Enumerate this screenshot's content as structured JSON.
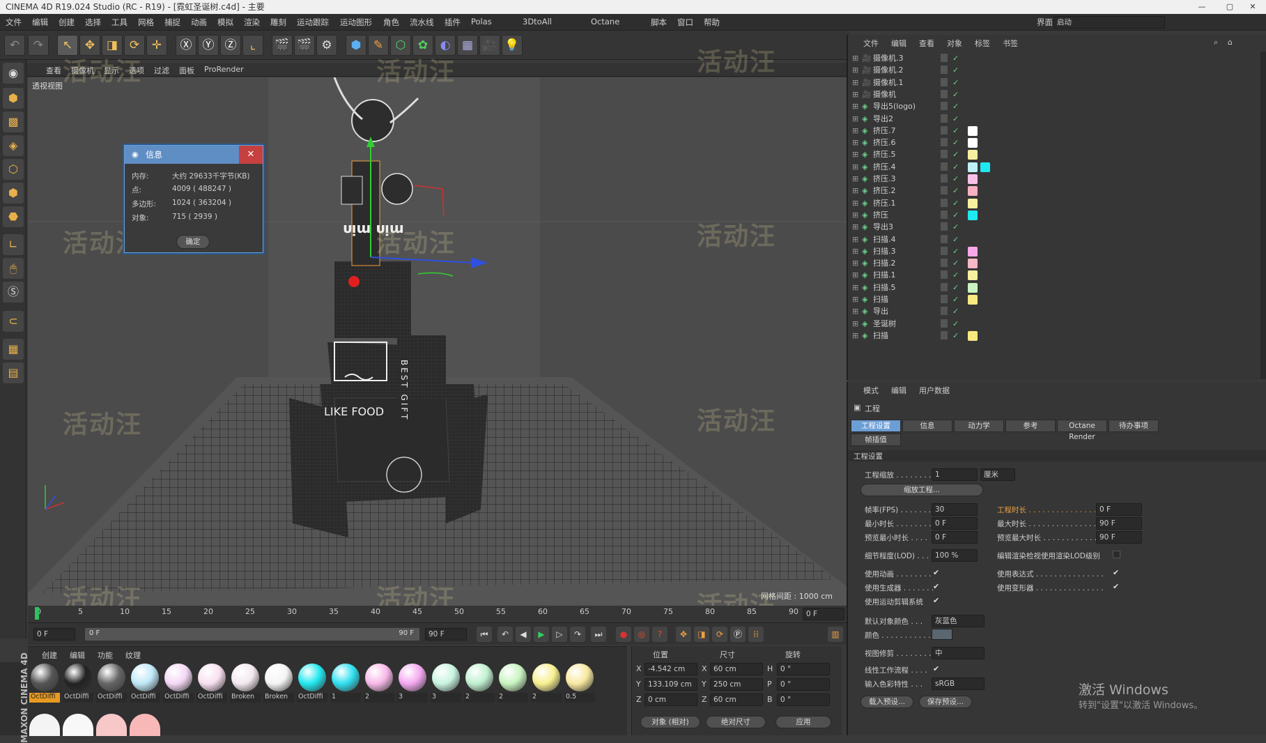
{
  "window": {
    "title": "CINEMA 4D R19.024 Studio (RC - R19) - [霓虹圣诞树.c4d] - 主要",
    "layout_label": "界面:",
    "layout_value": "启动"
  },
  "menu": [
    "文件",
    "编辑",
    "创建",
    "选择",
    "工具",
    "网格",
    "捕捉",
    "动画",
    "模拟",
    "渲染",
    "雕刻",
    "运动跟踪",
    "运动图形",
    "角色",
    "流水线",
    "插件",
    "Polas",
    "3DtoAll",
    "Octane",
    "脚本",
    "窗口",
    "帮助"
  ],
  "viewport": {
    "menu": [
      "查看",
      "摄像机",
      "显示",
      "选项",
      "过滤",
      "面板",
      "ProRender"
    ],
    "label": "透视视图",
    "grid_spacing": "网格间距 : 1000 cm"
  },
  "info_dialog": {
    "title": "信息",
    "close": "✕",
    "ok": "确定",
    "rows": [
      {
        "k": "内存:",
        "v": "大约 29633千字节(KB)"
      },
      {
        "k": "点:",
        "v": "4009 ( 488247 )"
      },
      {
        "k": "多边形:",
        "v": "1024 ( 363204 )"
      },
      {
        "k": "对象:",
        "v": "715 ( 2939 )"
      }
    ]
  },
  "scene": {
    "box_text": "LIKE FOOD",
    "side_text": "BEST GIFT",
    "mid_text": "ᴜᴉɯ ᴜᴉɯ"
  },
  "watermark": "活动汪",
  "timeline": {
    "ticks": [
      "0",
      "5",
      "10",
      "15",
      "20",
      "25",
      "30",
      "35",
      "40",
      "45",
      "50",
      "55",
      "60",
      "65",
      "70",
      "75",
      "80",
      "85",
      "90"
    ],
    "end_field": "0 F"
  },
  "transport": {
    "current": "0 F",
    "range_start": "0 F",
    "range_end": "90 F",
    "max": "90 F"
  },
  "materials": {
    "menu": [
      "创建",
      "编辑",
      "功能",
      "纹理"
    ],
    "items": [
      {
        "label": "OctDiffi",
        "color": "#555"
      },
      {
        "label": "OctDiffi",
        "color": "#222"
      },
      {
        "label": "OctDiffi",
        "color": "#666"
      },
      {
        "label": "OctDiffi",
        "color": "#bfe8f8"
      },
      {
        "label": "OctDiffi",
        "color": "#f4d8f4"
      },
      {
        "label": "OctDiffi",
        "color": "#f8e0f0"
      },
      {
        "label": "Broken",
        "color": "#f4e8f0"
      },
      {
        "label": "Broken",
        "color": "#f4f4f4"
      },
      {
        "label": "OctDiffi",
        "color": "#20e8f0"
      },
      {
        "label": "1",
        "color": "#30e0f0"
      },
      {
        "label": "2",
        "color": "#f8b8e8"
      },
      {
        "label": "3",
        "color": "#f4a8f0"
      },
      {
        "label": "3",
        "color": "#c8f4e0"
      },
      {
        "label": "2",
        "color": "#c0f0d0"
      },
      {
        "label": "2",
        "color": "#c8f4c0"
      },
      {
        "label": "2",
        "color": "#f8f090"
      },
      {
        "label": "0.5",
        "color": "#f8e8a0"
      }
    ]
  },
  "coords": {
    "headers": [
      "位置",
      "尺寸",
      "旋转"
    ],
    "rows": [
      {
        "a": "X",
        "p": "-4.542 cm",
        "b": "X",
        "s": "60 cm",
        "c": "H",
        "r": "0 °"
      },
      {
        "a": "Y",
        "p": "133.109 cm",
        "b": "Y",
        "s": "250 cm",
        "c": "P",
        "r": "0 °"
      },
      {
        "a": "Z",
        "p": "0 cm",
        "b": "Z",
        "s": "60 cm",
        "c": "B",
        "r": "0 °"
      }
    ],
    "mode1": "对象 (相对)",
    "mode2": "绝对尺寸",
    "apply": "应用"
  },
  "object_manager": {
    "menu": [
      "文件",
      "编辑",
      "查看",
      "对象",
      "标签",
      "书签"
    ],
    "rows": [
      {
        "name": "摄像机.3",
        "tags": []
      },
      {
        "name": "摄像机.2",
        "tags": []
      },
      {
        "name": "摄像机.1",
        "tags": []
      },
      {
        "name": "摄像机",
        "tags": []
      },
      {
        "name": "导出5(logo)",
        "tags": []
      },
      {
        "name": "导出2",
        "tags": []
      },
      {
        "name": "挤压.7",
        "tags": [
          "#ffffff"
        ]
      },
      {
        "name": "挤压.6",
        "tags": [
          "#ffffff"
        ]
      },
      {
        "name": "挤压.5",
        "tags": [
          "#f8f0a0"
        ]
      },
      {
        "name": "挤压.4",
        "tags": [
          "#bff0f8",
          "#20e8f0"
        ]
      },
      {
        "name": "挤压.3",
        "tags": [
          "#f8c0e8"
        ]
      },
      {
        "name": "挤压.2",
        "tags": [
          "#f8b0c0"
        ]
      },
      {
        "name": "挤压.1",
        "tags": [
          "#f8f0a0"
        ]
      },
      {
        "name": "挤压",
        "tags": [
          "#20e8f0"
        ]
      },
      {
        "name": "导出3",
        "tags": []
      },
      {
        "name": "扫描.4",
        "tags": []
      },
      {
        "name": "扫描.3",
        "tags": [
          "#f8a8e8"
        ]
      },
      {
        "name": "扫描.2",
        "tags": [
          "#f8b8c8"
        ]
      },
      {
        "name": "扫描.1",
        "tags": [
          "#f8f0a0"
        ]
      },
      {
        "name": "扫描.5",
        "tags": [
          "#c8f4c0"
        ]
      },
      {
        "name": "扫描",
        "tags": [
          "#f8e880"
        ]
      },
      {
        "name": "导出",
        "tags": []
      },
      {
        "name": "圣诞树",
        "tags": []
      },
      {
        "name": "扫描",
        "tags": [
          "#f8e880"
        ]
      }
    ]
  },
  "attributes": {
    "menu": [
      "模式",
      "编辑",
      "用户数据"
    ],
    "section": "工程",
    "tabs": [
      "工程设置",
      "信息",
      "动力学",
      "参考",
      "Octane Render",
      "待办事项",
      "帧插值"
    ],
    "group": "工程设置",
    "scale_label": "工程缩放 . . . . . . . . .",
    "scale_value": "1",
    "scale_unit": "厘米",
    "scale_btn": "缩放工程...",
    "fps_label": "帧率(FPS) . . . . . . .",
    "fps": "30",
    "duration_label": "工程时长 . . . . . . . . . . . . . . . . .",
    "duration": "0 F",
    "min_label": "最小时长 . . . . . . . .",
    "min": "0 F",
    "max_label": "最大时长 . . . . . . . . . . . . . . . . .",
    "max": "90 F",
    "pmin_label": "预览最小时长 . . . .",
    "pmin": "0 F",
    "pmax_label": "预览最大时长 . . . . . . . . . . . . .",
    "pmax": "90 F",
    "lod_label": "细节程度(LOD) . . .",
    "lod": "100 %",
    "lod_render_label": "编辑渲染检视使用渲染LOD级别",
    "use_anim": "使用动画 . . . . . . . .",
    "use_expr": "使用表达式 . . . . . . . . . . . . . . .",
    "use_gen": "使用生成器 . . . . . . .",
    "use_deform": "使用变形器 . . . . . . . . . . . . . . .",
    "use_mograph": "使用运动剪辑系统",
    "def_color_label": "默认对象颜色 . . .",
    "def_color": "灰蓝色",
    "color_label": "颜色 . . . . . . . . . . . .",
    "clip_label": "视图修剪 . . . . . . . .",
    "clip": "中",
    "linear_label": "线性工作流程 . . . .",
    "input_label": "输入色彩特性 . . .",
    "input": "sRGB",
    "load_btn": "载入预设...",
    "save_btn": "保存预设..."
  },
  "activation": {
    "line1": "激活 Windows",
    "line2": "转到\"设置\"以激活 Windows。"
  },
  "brand": "MAXON CINEMA 4D",
  "colors": {
    "accent": "#6c9ed6",
    "orange": "#e89a20",
    "bg": "#3a3a3a"
  }
}
